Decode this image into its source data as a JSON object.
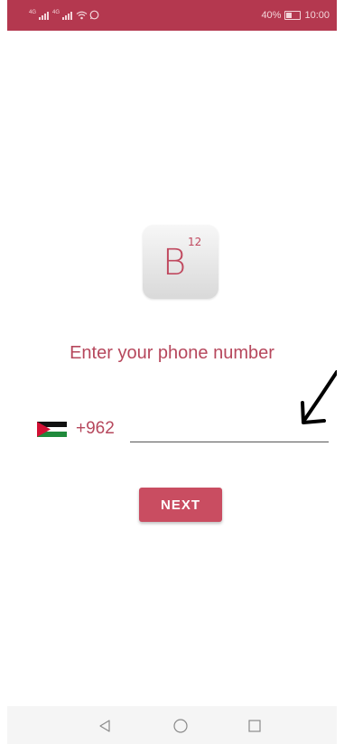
{
  "status_bar": {
    "network_1": "4G",
    "network_2": "4G",
    "battery_percent": "40%",
    "time": "10:00"
  },
  "logo": {
    "letter": "B",
    "superscript": "12"
  },
  "prompt": "Enter your phone number",
  "phone": {
    "country_code": "+962",
    "flag_icon": "jordan-flag",
    "value": "",
    "placeholder": ""
  },
  "next_button": "NEXT",
  "colors": {
    "accent": "#b4384f",
    "button": "#c94d61",
    "text_accent": "#b6475c"
  },
  "nav_bar": {
    "icons": [
      "back-icon",
      "home-icon",
      "recents-icon"
    ]
  }
}
